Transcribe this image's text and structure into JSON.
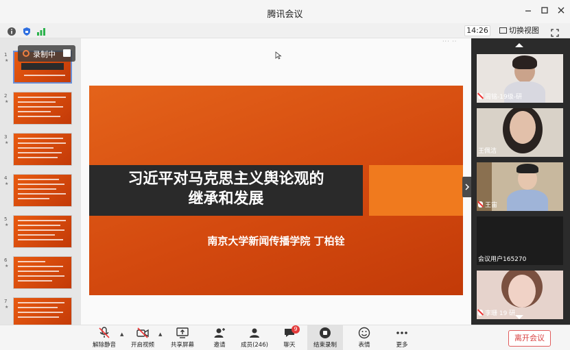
{
  "window": {
    "title": "腾讯会议"
  },
  "infobar": {
    "clock": "14:26",
    "switch_view": "切换视图"
  },
  "recording": {
    "label": "录制中"
  },
  "thumbnails": [
    {
      "num": "1",
      "star": "★"
    },
    {
      "num": "2",
      "star": "★"
    },
    {
      "num": "3",
      "star": "★"
    },
    {
      "num": "4",
      "star": "★"
    },
    {
      "num": "5",
      "star": "★"
    },
    {
      "num": "6",
      "star": "★"
    },
    {
      "num": "7",
      "star": "★"
    }
  ],
  "slide": {
    "title_line1": "习近平对马克思主义舆论观的",
    "title_line2": "继承和发展",
    "subtitle": "南京大学新闻传播学院    丁柏铨"
  },
  "main": {
    "dots": "··· ··"
  },
  "participants": [
    {
      "name": "周铭-19级-研",
      "muted": true
    },
    {
      "name": "王佩洁",
      "muted": false
    },
    {
      "name": "王宙",
      "muted": true
    },
    {
      "name": "会议用户165270",
      "muted": false
    },
    {
      "name": "李珊 19 研",
      "muted": true
    }
  ],
  "toolbar": {
    "unmute": "解除静音",
    "start_video": "开启视频",
    "share_screen": "共享屏幕",
    "invite": "邀请",
    "members": "成员(246)",
    "chat": "聊天",
    "chat_badge": "9",
    "end_recording": "结束录制",
    "emoji": "表情",
    "more": "更多",
    "leave": "离开会议"
  },
  "colors": {
    "slide_orange": "#e4631a",
    "accent_orange": "#f07a1e",
    "leave_red": "#d94040",
    "badge_red": "#e43b3b"
  }
}
